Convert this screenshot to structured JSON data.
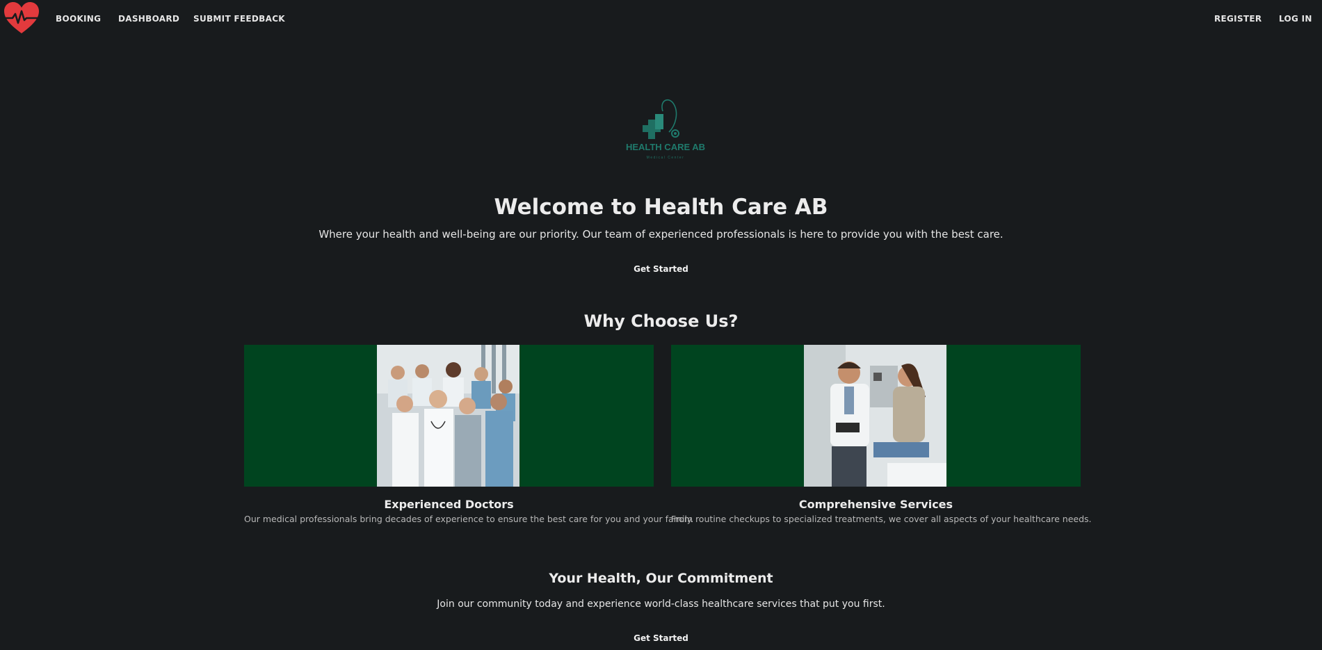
{
  "nav": {
    "links": [
      "BOOKING",
      "DASHBOARD",
      "SUBMIT FEEDBACK"
    ],
    "right_links": [
      "REGISTER",
      "LOG IN"
    ]
  },
  "hero": {
    "logo_text": "HEALTH CARE AB",
    "logo_tagline": "Medical Center",
    "title": "Welcome to Health Care AB",
    "subtitle": "Where your health and well-being are our priority. Our team of experienced professionals is here to provide you with the best care.",
    "cta": "Get Started"
  },
  "why": {
    "title": "Why Choose Us?",
    "cards": [
      {
        "title": "Experienced Doctors",
        "text": "Our medical professionals bring decades of experience to ensure the best care for you and your family."
      },
      {
        "title": "Comprehensive Services",
        "text": "From routine checkups to specialized treatments, we cover all aspects of your healthcare needs."
      }
    ]
  },
  "commitment": {
    "title": "Your Health, Our Commitment",
    "subtitle": "Join our community today and experience world-class healthcare services that put you first.",
    "cta": "Get Started"
  },
  "colors": {
    "background": "#181b1d",
    "card_green": "#00441f",
    "heart_red": "#e23a3d",
    "logo_teal": "#1f7a6c"
  },
  "icons": {
    "brand": "heart-pulse-icon"
  }
}
